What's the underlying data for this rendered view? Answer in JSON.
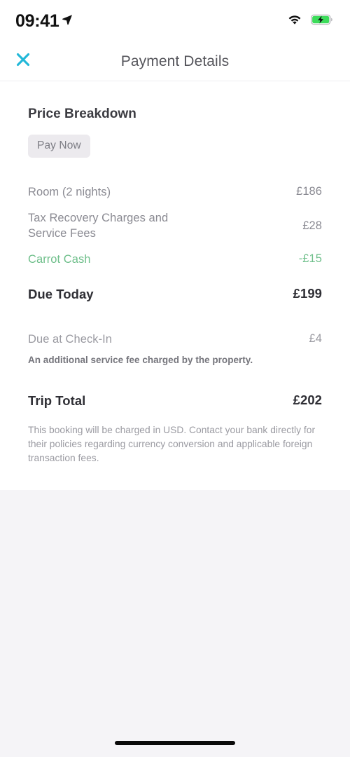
{
  "status_bar": {
    "time": "09:41",
    "location_icon": "location-arrow-icon",
    "wifi_icon": "wifi-icon",
    "battery_icon": "battery-charging-icon",
    "battery_color": "#3ddc5b"
  },
  "header": {
    "title": "Payment Details",
    "close_icon": "close-icon",
    "close_color": "#22b8d8"
  },
  "price_breakdown": {
    "section_title": "Price Breakdown",
    "badge_label": "Pay Now",
    "line_items": [
      {
        "label": "Room (2 nights)",
        "value": "£186",
        "credit": false
      },
      {
        "label": "Tax Recovery Charges and Service Fees",
        "value": "£28",
        "credit": false
      },
      {
        "label": "Carrot Cash",
        "value": "-£15",
        "credit": true
      }
    ],
    "due_today": {
      "label": "Due Today",
      "value": "£199"
    },
    "due_at_checkin": {
      "label": "Due at Check-In",
      "value": "£4",
      "note": "An additional service fee charged by the property."
    },
    "trip_total": {
      "label": "Trip Total",
      "value": "£202"
    },
    "disclaimer": "This booking will be charged in USD. Contact your bank directly for their policies regarding currency conversion and applicable foreign transaction fees.",
    "credit_color": "#6fbf8b"
  },
  "home_indicator": "home-indicator"
}
